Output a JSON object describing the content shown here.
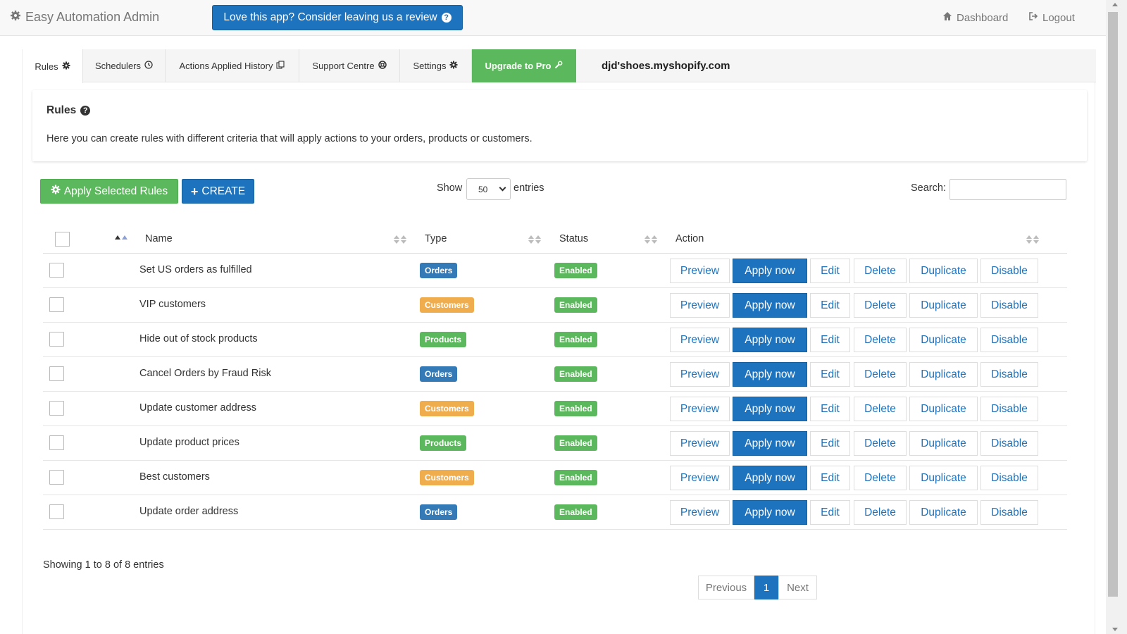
{
  "navbar": {
    "brand": "Easy Automation Admin",
    "review_button": "Love this app? Consider leaving us a review",
    "dashboard": "Dashboard",
    "logout": "Logout"
  },
  "tabs": {
    "rules": "Rules",
    "schedulers": "Schedulers",
    "history": "Actions Applied History",
    "support": "Support Centre",
    "settings": "Settings",
    "upgrade": "Upgrade to Pro",
    "shop": "djd'shoes.myshopify.com"
  },
  "info": {
    "title": "Rules",
    "text": "Here you can create rules with different criteria that will apply actions to your orders, products or customers."
  },
  "toolbar": {
    "apply_selected": "Apply Selected Rules",
    "create": "CREATE",
    "show": "Show",
    "entries_value": "50",
    "entries": "entries",
    "search_label": "Search:",
    "search_value": ""
  },
  "table": {
    "columns": {
      "name": "Name",
      "type": "Type",
      "status": "Status",
      "action": "Action"
    },
    "action_labels": {
      "preview": "Preview",
      "apply": "Apply now",
      "edit": "Edit",
      "delete": "Delete",
      "duplicate": "Duplicate",
      "disable": "Disable"
    },
    "rows": [
      {
        "name": "Set US orders as fulfilled",
        "type": "Orders",
        "status": "Enabled"
      },
      {
        "name": "VIP customers",
        "type": "Customers",
        "status": "Enabled"
      },
      {
        "name": "Hide out of stock products",
        "type": "Products",
        "status": "Enabled"
      },
      {
        "name": "Cancel Orders by Fraud Risk",
        "type": "Orders",
        "status": "Enabled"
      },
      {
        "name": "Update customer address",
        "type": "Customers",
        "status": "Enabled"
      },
      {
        "name": "Update product prices",
        "type": "Products",
        "status": "Enabled"
      },
      {
        "name": "Best customers",
        "type": "Customers",
        "status": "Enabled"
      },
      {
        "name": "Update order address",
        "type": "Orders",
        "status": "Enabled"
      }
    ]
  },
  "type_colors": {
    "Orders": "#337ab7",
    "Customers": "#f0ad4e",
    "Products": "#5cb85c"
  },
  "footer": {
    "showing": "Showing 1 to 8 of 8 entries",
    "previous": "Previous",
    "page": "1",
    "next": "Next"
  }
}
